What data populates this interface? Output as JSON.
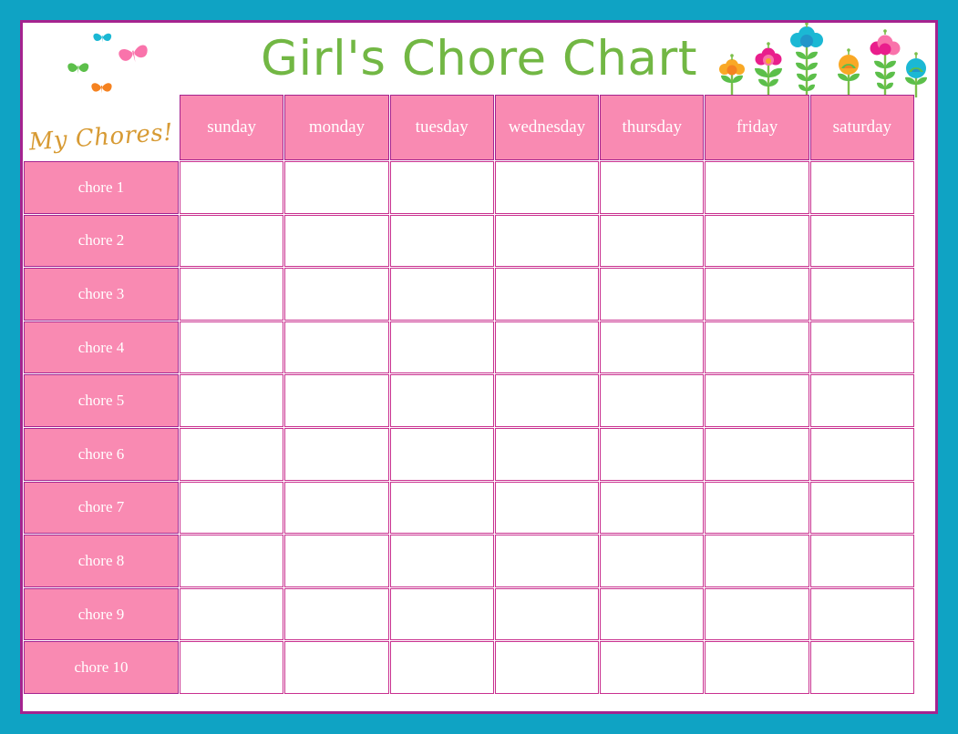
{
  "header": {
    "title": "Girl's Chore Chart",
    "corner_label": "My Chores!"
  },
  "colors": {
    "outer_border": "#0fa3c4",
    "inner_border": "#a5238f",
    "header_pink": "#f98ab2",
    "grid_line": "#c9308f",
    "title_green": "#72b744",
    "script_gold": "#d79a33",
    "cell_white": "#ffffff"
  },
  "table": {
    "day_headers": [
      "sunday",
      "monday",
      "tuesday",
      "wednesday",
      "thursday",
      "friday",
      "saturday"
    ],
    "chore_rows": [
      "chore 1",
      "chore 2",
      "chore 3",
      "chore 4",
      "chore 5",
      "chore 6",
      "chore 7",
      "chore 8",
      "chore 9",
      "chore 10"
    ],
    "cell_values": [
      [
        "",
        "",
        "",
        "",
        "",
        "",
        ""
      ],
      [
        "",
        "",
        "",
        "",
        "",
        "",
        ""
      ],
      [
        "",
        "",
        "",
        "",
        "",
        "",
        ""
      ],
      [
        "",
        "",
        "",
        "",
        "",
        "",
        ""
      ],
      [
        "",
        "",
        "",
        "",
        "",
        "",
        ""
      ],
      [
        "",
        "",
        "",
        "",
        "",
        "",
        ""
      ],
      [
        "",
        "",
        "",
        "",
        "",
        "",
        ""
      ],
      [
        "",
        "",
        "",
        "",
        "",
        "",
        ""
      ],
      [
        "",
        "",
        "",
        "",
        "",
        "",
        ""
      ],
      [
        "",
        "",
        "",
        "",
        "",
        "",
        ""
      ]
    ]
  },
  "decorations": {
    "butterflies": [
      {
        "name": "butterfly-teal",
        "color": "#1bb8d4"
      },
      {
        "name": "butterfly-green",
        "color": "#5cbf4a"
      },
      {
        "name": "butterfly-pink",
        "color": "#f973ab"
      },
      {
        "name": "butterfly-orange",
        "color": "#f58220"
      }
    ],
    "flowers": [
      {
        "name": "flower-orange",
        "bloom": "#f9a825",
        "accent": "#f58220"
      },
      {
        "name": "flower-magenta",
        "bloom": "#e91e8c",
        "accent": "#f973ab"
      },
      {
        "name": "flower-blue-tall",
        "bloom": "#1bb8d4",
        "accent": "#2196c9"
      },
      {
        "name": "flower-orange-ring",
        "bloom": "#f9a825",
        "accent": "#f58220"
      },
      {
        "name": "flower-pink-tall",
        "bloom": "#f973ab",
        "accent": "#e91e8c"
      },
      {
        "name": "flower-blue-ring",
        "bloom": "#1bb8d4",
        "accent": "#2196c9"
      }
    ],
    "stem_green": "#7cbf4a",
    "leaf_green": "#5cbf4a"
  }
}
